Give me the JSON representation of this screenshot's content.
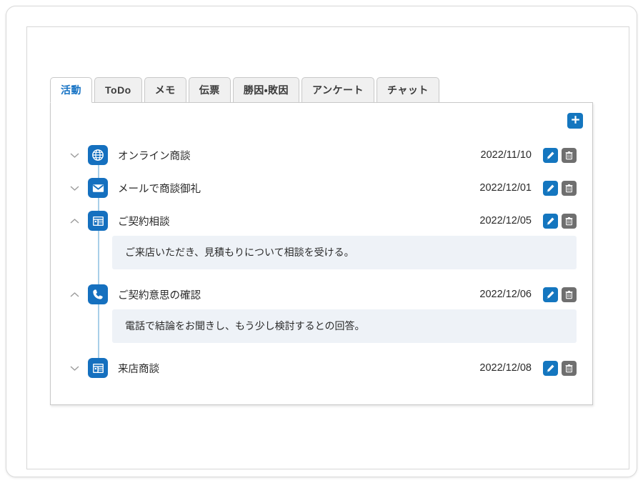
{
  "tabs": [
    {
      "label": "活動",
      "active": true
    },
    {
      "label": "ToDo",
      "active": false
    },
    {
      "label": "メモ",
      "active": false
    },
    {
      "label": "伝票",
      "active": false
    },
    {
      "label": "勝因・敗因",
      "active": false
    },
    {
      "label": "アンケート",
      "active": false
    },
    {
      "label": "チャット",
      "active": false
    }
  ],
  "toolbar": {
    "add_label": "+",
    "add_icon": "plus-icon"
  },
  "row_actions": {
    "edit_icon": "pencil-icon",
    "delete_icon": "trash-icon"
  },
  "colors": {
    "accent_blue": "#1570bf",
    "edit_blue": "#1476bf",
    "delete_gray": "#6f6f6f",
    "tab_active_text": "#1572c4",
    "detail_bg": "#eef2f7",
    "timeline_line": "#a8cfe8",
    "panel_border": "#c8c8c8"
  },
  "activities": [
    {
      "title": "オンライン商談",
      "date": "2022/11/10",
      "icon": "globe-icon",
      "expanded": false,
      "chevron": "chevron-down-icon",
      "detail": ""
    },
    {
      "title": "メールで商談御礼",
      "date": "2022/12/01",
      "icon": "envelope-icon",
      "expanded": false,
      "chevron": "chevron-down-icon",
      "detail": ""
    },
    {
      "title": "ご契約相談",
      "date": "2022/12/05",
      "icon": "store-icon",
      "expanded": true,
      "chevron": "chevron-up-icon",
      "detail": "ご来店いただき、見積もりについて相談を受ける。"
    },
    {
      "title": "ご契約意思の確認",
      "date": "2022/12/06",
      "icon": "phone-icon",
      "expanded": true,
      "chevron": "chevron-up-icon",
      "detail": "電話で結論をお聞きし、もう少し検討するとの回答。"
    },
    {
      "title": "来店商談",
      "date": "2022/12/08",
      "icon": "store-icon",
      "expanded": false,
      "chevron": "chevron-down-icon",
      "detail": ""
    }
  ]
}
